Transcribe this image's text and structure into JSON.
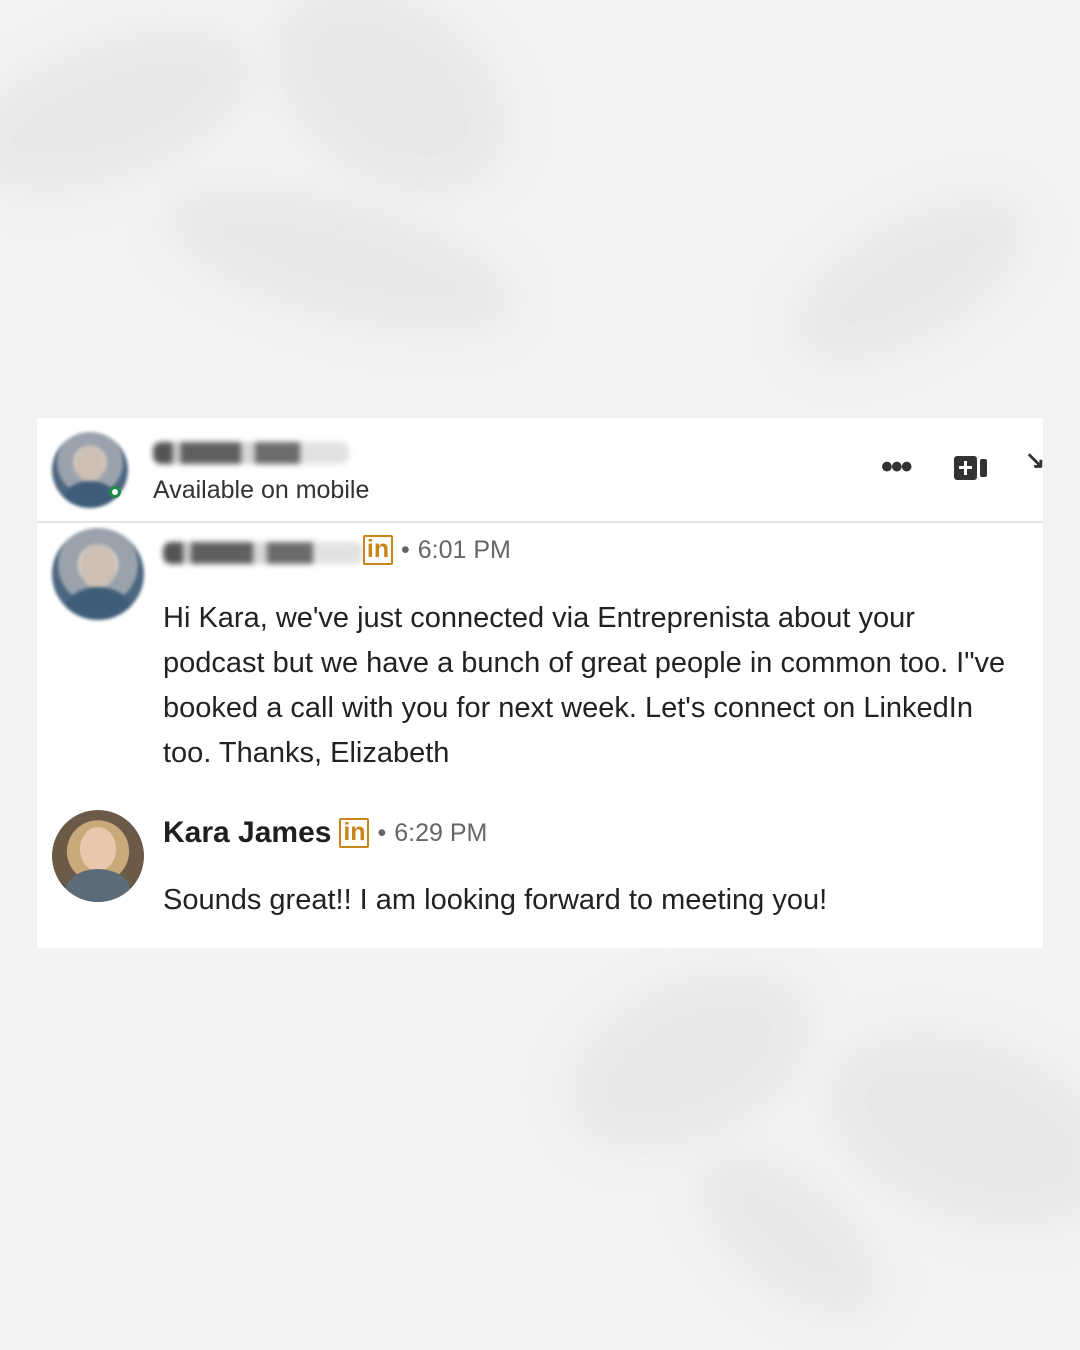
{
  "conversation": {
    "contact_status": "Available on mobile",
    "icons": [
      "more-icon",
      "video-call-icon",
      "collapse-icon"
    ],
    "link_badge": "in",
    "colors": {
      "linkedin_badge": "#c8861a",
      "online": "#1d8a45",
      "text": "#222222",
      "muted": "#666666"
    }
  },
  "messages": [
    {
      "sender": "",
      "time": "6:01 PM",
      "text": "Hi Kara, we've just connected via Entreprenista about your podcast but we have a bunch of great people in common too. I\"ve booked a call with you for next week. Let's connect on LinkedIn too. Thanks, Elizabeth"
    },
    {
      "sender": "Kara James",
      "time": "6:29 PM",
      "text": "Sounds great!! I am looking forward to meeting you!"
    }
  ],
  "labels": {
    "separator": "•",
    "more": "•••",
    "collapse": "↘"
  }
}
